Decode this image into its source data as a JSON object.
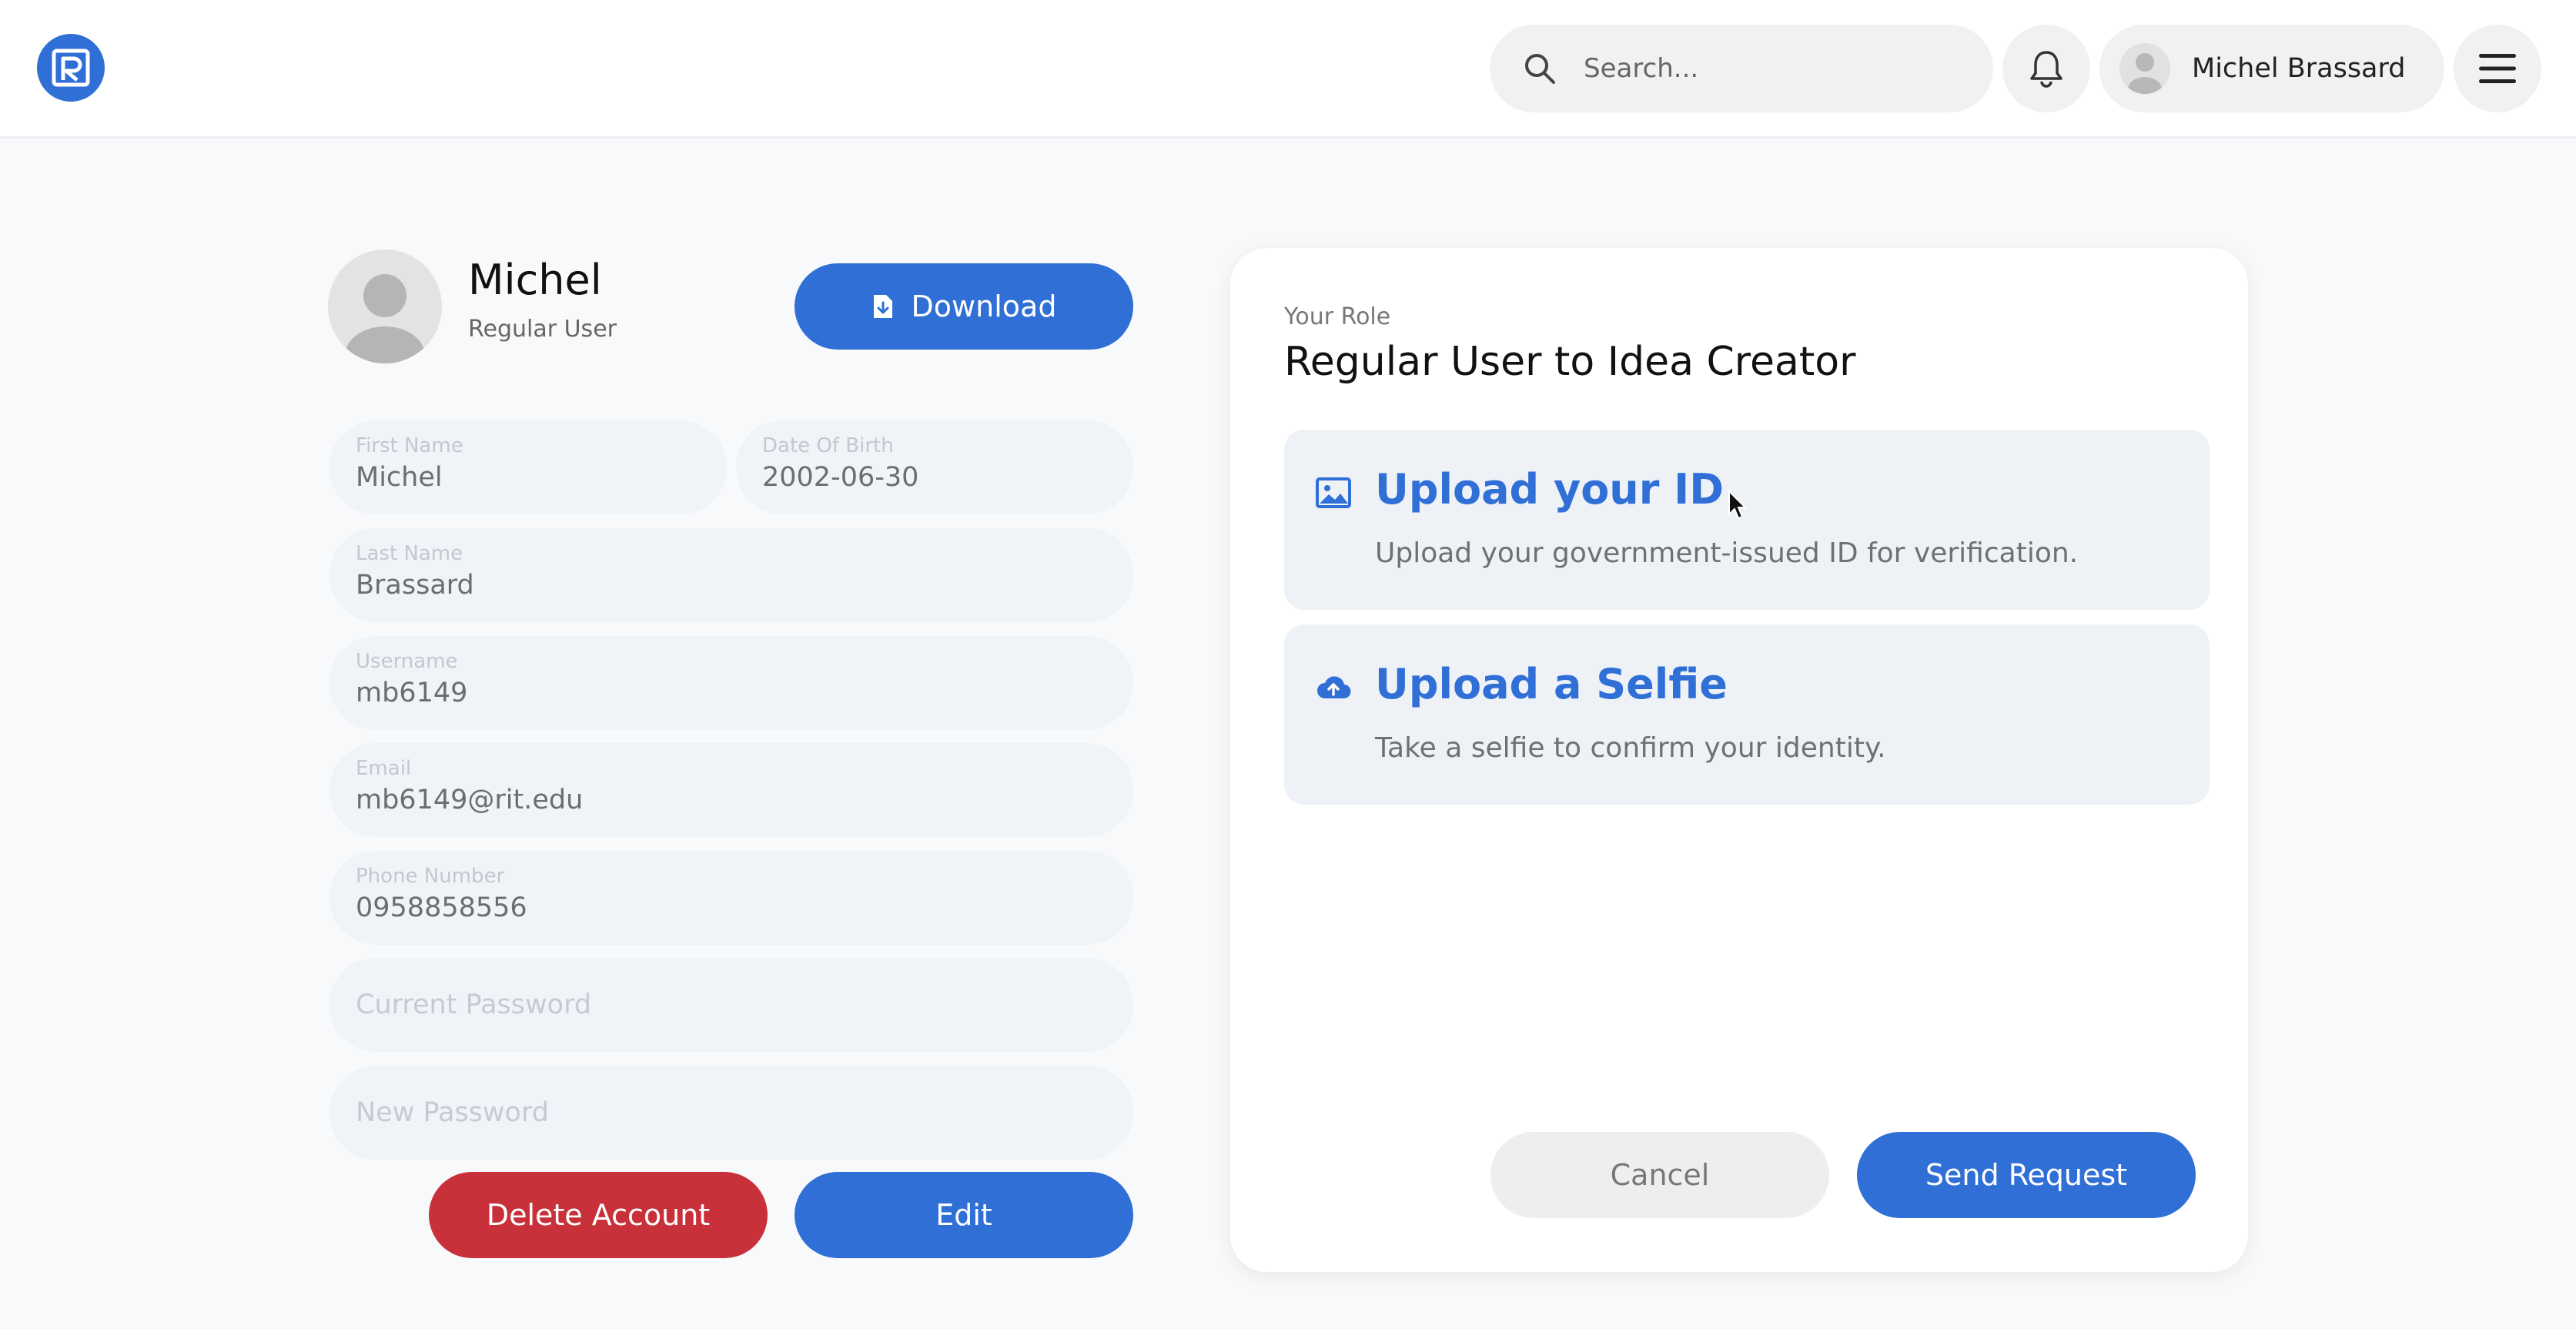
{
  "header": {
    "search_placeholder": "Search...",
    "user_name": "Michel Brassard"
  },
  "profile": {
    "name": "Michel",
    "role": "Regular User",
    "download_label": "Download",
    "fields": {
      "first_name": {
        "label": "First Name",
        "value": "Michel"
      },
      "date_of_birth": {
        "label": "Date Of Birth",
        "value": "2002-06-30"
      },
      "last_name": {
        "label": "Last Name",
        "value": "Brassard"
      },
      "username": {
        "label": "Username",
        "value": "mb6149"
      },
      "email": {
        "label": "Email",
        "value": "mb6149@rit.edu"
      },
      "phone": {
        "label": "Phone Number",
        "value": "0958858556"
      },
      "current_password": {
        "placeholder": "Current Password"
      },
      "new_password": {
        "placeholder": "New Password"
      }
    },
    "delete_label": "Delete Account",
    "edit_label": "Edit"
  },
  "role_card": {
    "label": "Your Role",
    "title": "Regular User to Idea Creator",
    "upload_id": {
      "icon": "image-icon",
      "title": "Upload your ID",
      "description": "Upload your government-issued ID for verification."
    },
    "upload_selfie": {
      "icon": "cloud-upload-icon",
      "title": "Upload a Selfie",
      "description": "Take a selfie to confirm your identity."
    },
    "cancel_label": "Cancel",
    "send_label": "Send Request"
  },
  "colors": {
    "primary": "#2f6fd6",
    "danger": "#c8303a",
    "field_bg": "#f0f3f7"
  }
}
